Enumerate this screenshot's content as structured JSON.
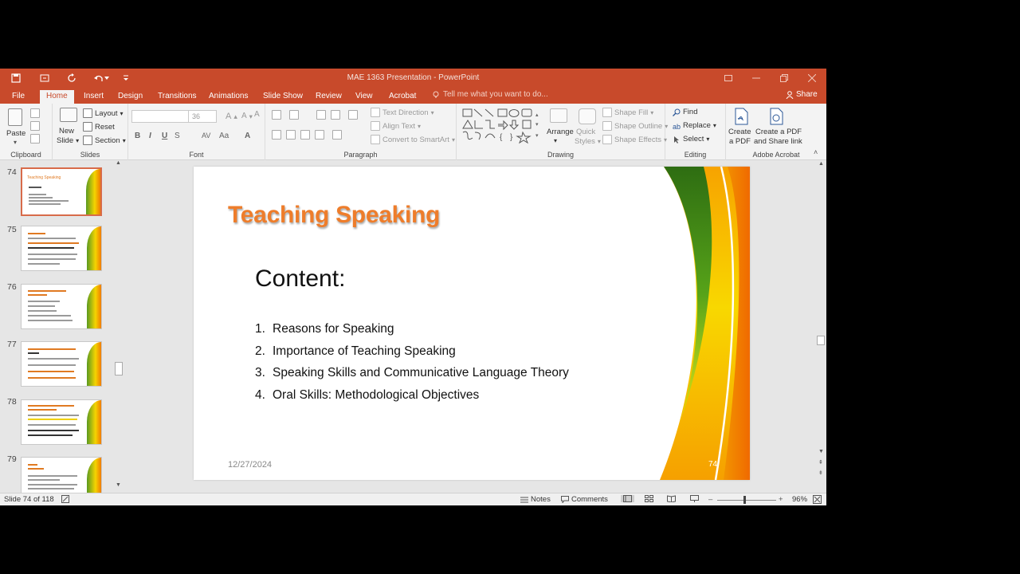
{
  "window": {
    "title": "MAE 1363 Presentation - PowerPoint"
  },
  "tabs": [
    "File",
    "Home",
    "Insert",
    "Design",
    "Transitions",
    "Animations",
    "Slide Show",
    "Review",
    "View",
    "Acrobat"
  ],
  "tell_me": "Tell me what you want to do...",
  "share_label": "Share",
  "ribbon": {
    "clipboard": {
      "paste": "Paste",
      "label": "Clipboard"
    },
    "slides": {
      "new_slide_1": "New",
      "new_slide_2": "Slide",
      "layout": "Layout",
      "reset": "Reset",
      "section": "Section",
      "label": "Slides"
    },
    "font": {
      "size": "36",
      "label": "Font",
      "bold": "B",
      "italic": "I",
      "underline": "U",
      "strike": "S",
      "spacing": "AV",
      "case": "Aa",
      "clear": "A"
    },
    "paragraph": {
      "text_direction": "Text Direction",
      "align_text": "Align Text",
      "smartart": "Convert to SmartArt",
      "label": "Paragraph"
    },
    "drawing": {
      "arrange": "Arrange",
      "quick_styles_1": "Quick",
      "quick_styles_2": "Styles",
      "shape_fill": "Shape Fill",
      "shape_outline": "Shape Outline",
      "shape_effects": "Shape Effects",
      "label": "Drawing"
    },
    "editing": {
      "find": "Find",
      "replace": "Replace",
      "select": "Select",
      "label": "Editing"
    },
    "acrobat": {
      "create_pdf_1": "Create",
      "create_pdf_2": "a PDF",
      "share_pdf_1": "Create a PDF",
      "share_pdf_2": "and Share link",
      "label": "Adobe Acrobat"
    }
  },
  "thumbnails": [
    {
      "num": "74",
      "title": "Teaching Speaking"
    },
    {
      "num": "75",
      "title": ""
    },
    {
      "num": "76",
      "title": ""
    },
    {
      "num": "77",
      "title": ""
    },
    {
      "num": "78",
      "title": ""
    },
    {
      "num": "79",
      "title": ""
    }
  ],
  "slide": {
    "title": "Teaching Speaking",
    "subtitle": "Content:",
    "items": [
      {
        "n": "1.",
        "text": "Reasons for Speaking"
      },
      {
        "n": "2.",
        "text": "Importance of Teaching Speaking"
      },
      {
        "n": "3.",
        "text": "Speaking Skills and Communicative Language Theory"
      },
      {
        "n": "4.",
        "text": "Oral Skills: Methodological Objectives"
      }
    ],
    "date": "12/27/2024",
    "page": "74"
  },
  "status": {
    "slide_info": "Slide 74 of 118",
    "notes": "Notes",
    "comments": "Comments",
    "zoom": "96%"
  },
  "colors": {
    "accent": "#c84a2b",
    "title_orange": "#ee7d2b"
  }
}
